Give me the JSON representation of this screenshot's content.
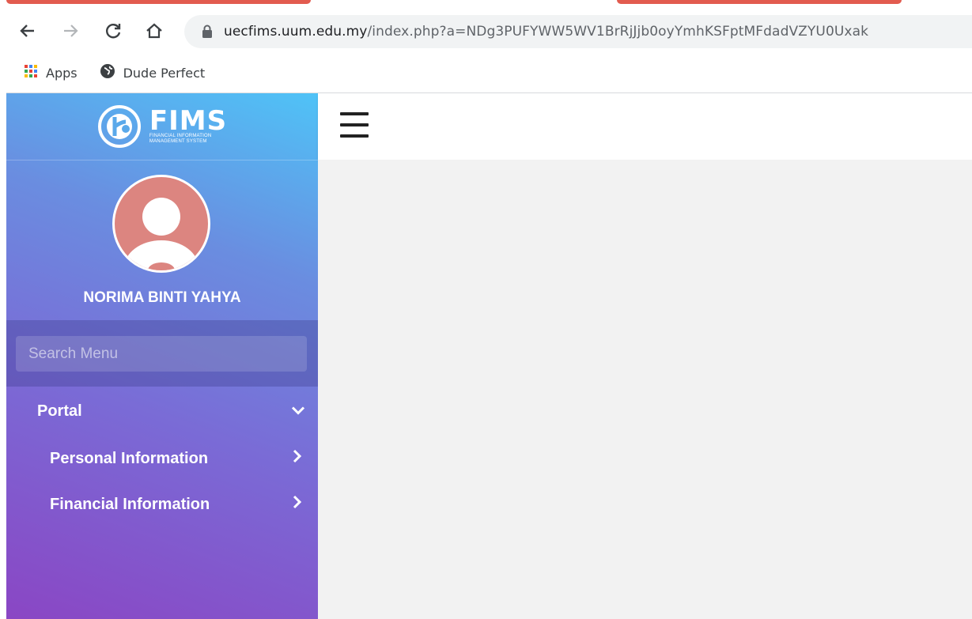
{
  "browser": {
    "url_domain": "uecfims.uum.edu.my",
    "url_path": "/index.php?a=NDg3PUFYWW5WV1BrRjJjb0oyYmhKSFptMFdadVZYU0Uxak",
    "bookmarks": [
      {
        "label": "Apps",
        "icon": "apps-grid-icon"
      },
      {
        "label": "Dude Perfect",
        "icon": "globe-icon"
      }
    ],
    "accent_color": "#e25b4f"
  },
  "brand": {
    "name": "FIMS",
    "subtitle_line1": "FINANCIAL INFORMATION",
    "subtitle_line2": "MANAGEMENT SYSTEM"
  },
  "user": {
    "name": "NORIMA BINTI YAHYA",
    "avatar_color": "#dc8580"
  },
  "search": {
    "placeholder": "Search Menu",
    "value": ""
  },
  "menu": {
    "items": [
      {
        "label": "Portal",
        "icon": "chevron-down-icon"
      },
      {
        "label": "Personal Information",
        "icon": "chevron-right-icon"
      },
      {
        "label": "Financial Information",
        "icon": "chevron-right-icon"
      }
    ]
  },
  "topbar": {
    "menu_toggle_icon": "hamburger-icon"
  },
  "theme": {
    "sidebar_gradient": [
      "#4fc3f7",
      "#6a8de0",
      "#7a6bd6",
      "#8a46c4"
    ],
    "content_background": "#f2f2f2"
  }
}
